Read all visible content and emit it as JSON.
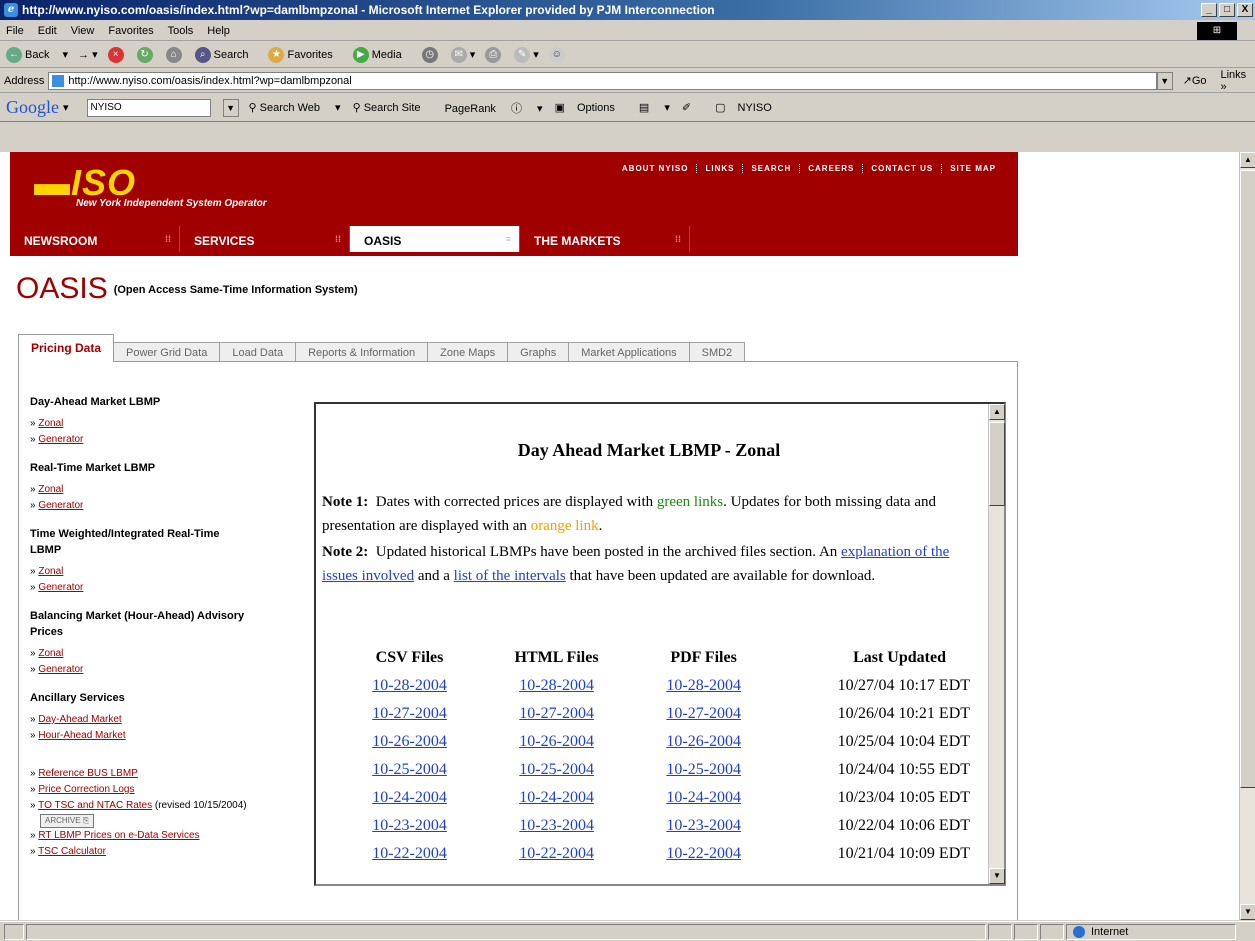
{
  "window": {
    "title": "http://www.nyiso.com/oasis/index.html?wp=damlbmpzonal - Microsoft Internet Explorer provided by PJM Interconnection",
    "min": "_",
    "max": "□",
    "close": "X"
  },
  "menu": [
    "File",
    "Edit",
    "View",
    "Favorites",
    "Tools",
    "Help"
  ],
  "toolbar": [
    "Back",
    "Search",
    "Favorites",
    "Media"
  ],
  "address": {
    "label": "Address",
    "url": "http://www.nyiso.com/oasis/index.html?wp=damlbmpzonal",
    "go": "Go",
    "links": "Links"
  },
  "google": {
    "logo": "Google",
    "query": "NYISO",
    "search_web": "Search Web",
    "search_site": "Search Site",
    "pagerank": "PageRank",
    "options": "Options",
    "nyiso": "NYISO"
  },
  "header": {
    "logo": "ISO",
    "tagline": "New York Independent System Operator",
    "toplinks": [
      "ABOUT NYISO",
      "LINKS",
      "SEARCH",
      "CAREERS",
      "CONTACT US",
      "SITE MAP"
    ],
    "nav": [
      "NEWSROOM",
      "SERVICES",
      "OASIS",
      "THE MARKETS"
    ]
  },
  "page": {
    "title": "OASIS",
    "subtitle": "(Open Access Same-Time Information System)"
  },
  "tabs": [
    "Pricing Data",
    "Power Grid Data",
    "Load Data",
    "Reports & Information",
    "Zone Maps",
    "Graphs",
    "Market Applications",
    "SMD2"
  ],
  "sidebar": {
    "groups": [
      {
        "heading": "Day-Ahead Market LBMP",
        "links": [
          "Zonal",
          "Generator"
        ]
      },
      {
        "heading": "Real-Time Market LBMP",
        "links": [
          "Zonal",
          "Generator"
        ]
      },
      {
        "heading": "Time Weighted/Integrated Real-Time LBMP",
        "links": [
          "Zonal",
          "Generator"
        ]
      },
      {
        "heading": "Balancing Market (Hour-Ahead) Advisory Prices",
        "links": [
          "Zonal",
          "Generator"
        ]
      },
      {
        "heading": "Ancillary Services",
        "links": [
          "Day-Ahead Market",
          "Hour-Ahead Market"
        ]
      }
    ],
    "misc_links": [
      "Reference BUS LBMP",
      "Price Correction Logs",
      "TO TSC and NTAC Rates",
      "RT LBMP Prices on e-Data Services",
      "TSC Calculator"
    ],
    "revised_note": "(revised 10/15/2004)",
    "archive_label": "ARCHIVE"
  },
  "iframe": {
    "heading": "Day Ahead Market LBMP - Zonal",
    "note1_label": "Note 1:",
    "note1_a": "Dates with corrected prices are displayed with",
    "note1_green": "green links",
    "note1_b": ". Updates for both missing data and presentation are displayed with an",
    "note1_orange": "orange link",
    "note1_c": ".",
    "note2_label": "Note 2:",
    "note2_a": "Updated historical LBMPs have been posted in the archived files section. An",
    "note2_link1": "explanation of the issues involved",
    "note2_b": "and a",
    "note2_link2": "list of the intervals",
    "note2_c": "that have been updated are available for download.",
    "columns": [
      "CSV Files",
      "HTML Files",
      "PDF Files",
      "Last Updated"
    ],
    "rows": [
      {
        "date": "10-28-2004",
        "updated": "10/27/04 10:17 EDT"
      },
      {
        "date": "10-27-2004",
        "updated": "10/26/04 10:21 EDT"
      },
      {
        "date": "10-26-2004",
        "updated": "10/25/04 10:04 EDT"
      },
      {
        "date": "10-25-2004",
        "updated": "10/24/04 10:55 EDT"
      },
      {
        "date": "10-24-2004",
        "updated": "10/23/04 10:05 EDT"
      },
      {
        "date": "10-23-2004",
        "updated": "10/22/04 10:06 EDT"
      },
      {
        "date": "10-22-2004",
        "updated": "10/21/04 10:09 EDT"
      }
    ]
  },
  "status": {
    "zone": "Internet"
  },
  "colors": {
    "brand_red": "#a00000",
    "logo_yellow": "#ffd400",
    "link_blue": "#1f3fd0",
    "green": "#1a8a1a",
    "orange": "#f0a000"
  }
}
